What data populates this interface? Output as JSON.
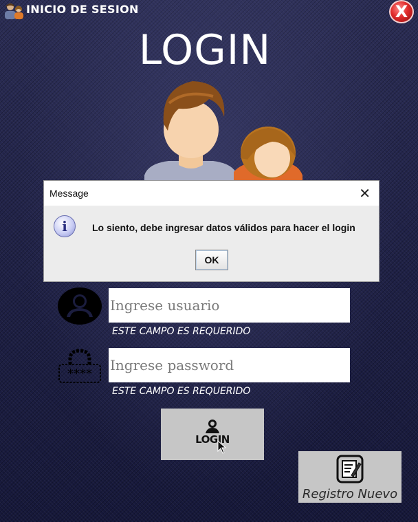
{
  "window": {
    "title": "INICIO DE SESION",
    "icon": "users-icon",
    "close_icon": "close-icon",
    "close_label": "X"
  },
  "login_title": "LOGIN",
  "illustration": "users-avatars-illustration",
  "dialog": {
    "title": "Message",
    "close_label": "✕",
    "icon": "info-icon",
    "icon_label": "i",
    "message": "Lo siento, debe ingresar datos válidos para hacer el login",
    "ok_label": "OK"
  },
  "form": {
    "user_icon": "user-icon",
    "user_placeholder": "Ingrese usuario",
    "user_value": "",
    "user_note": "ESTE CAMPO ES REQUERIDO",
    "pass_icon": "password-icon",
    "pass_placeholder": "Ingrese password",
    "pass_value": "",
    "pass_note": "ESTE CAMPO ES REQUERIDO"
  },
  "login_button": {
    "label": "LOGIN",
    "icon": "login-user-icon"
  },
  "register_button": {
    "label": "Registro Nuevo",
    "icon": "register-note-icon"
  },
  "colors": {
    "background": "#1b1d3e",
    "close_red": "#e02a2a",
    "dialog_bg": "#ececec",
    "button_gray": "#c6c6c6"
  }
}
